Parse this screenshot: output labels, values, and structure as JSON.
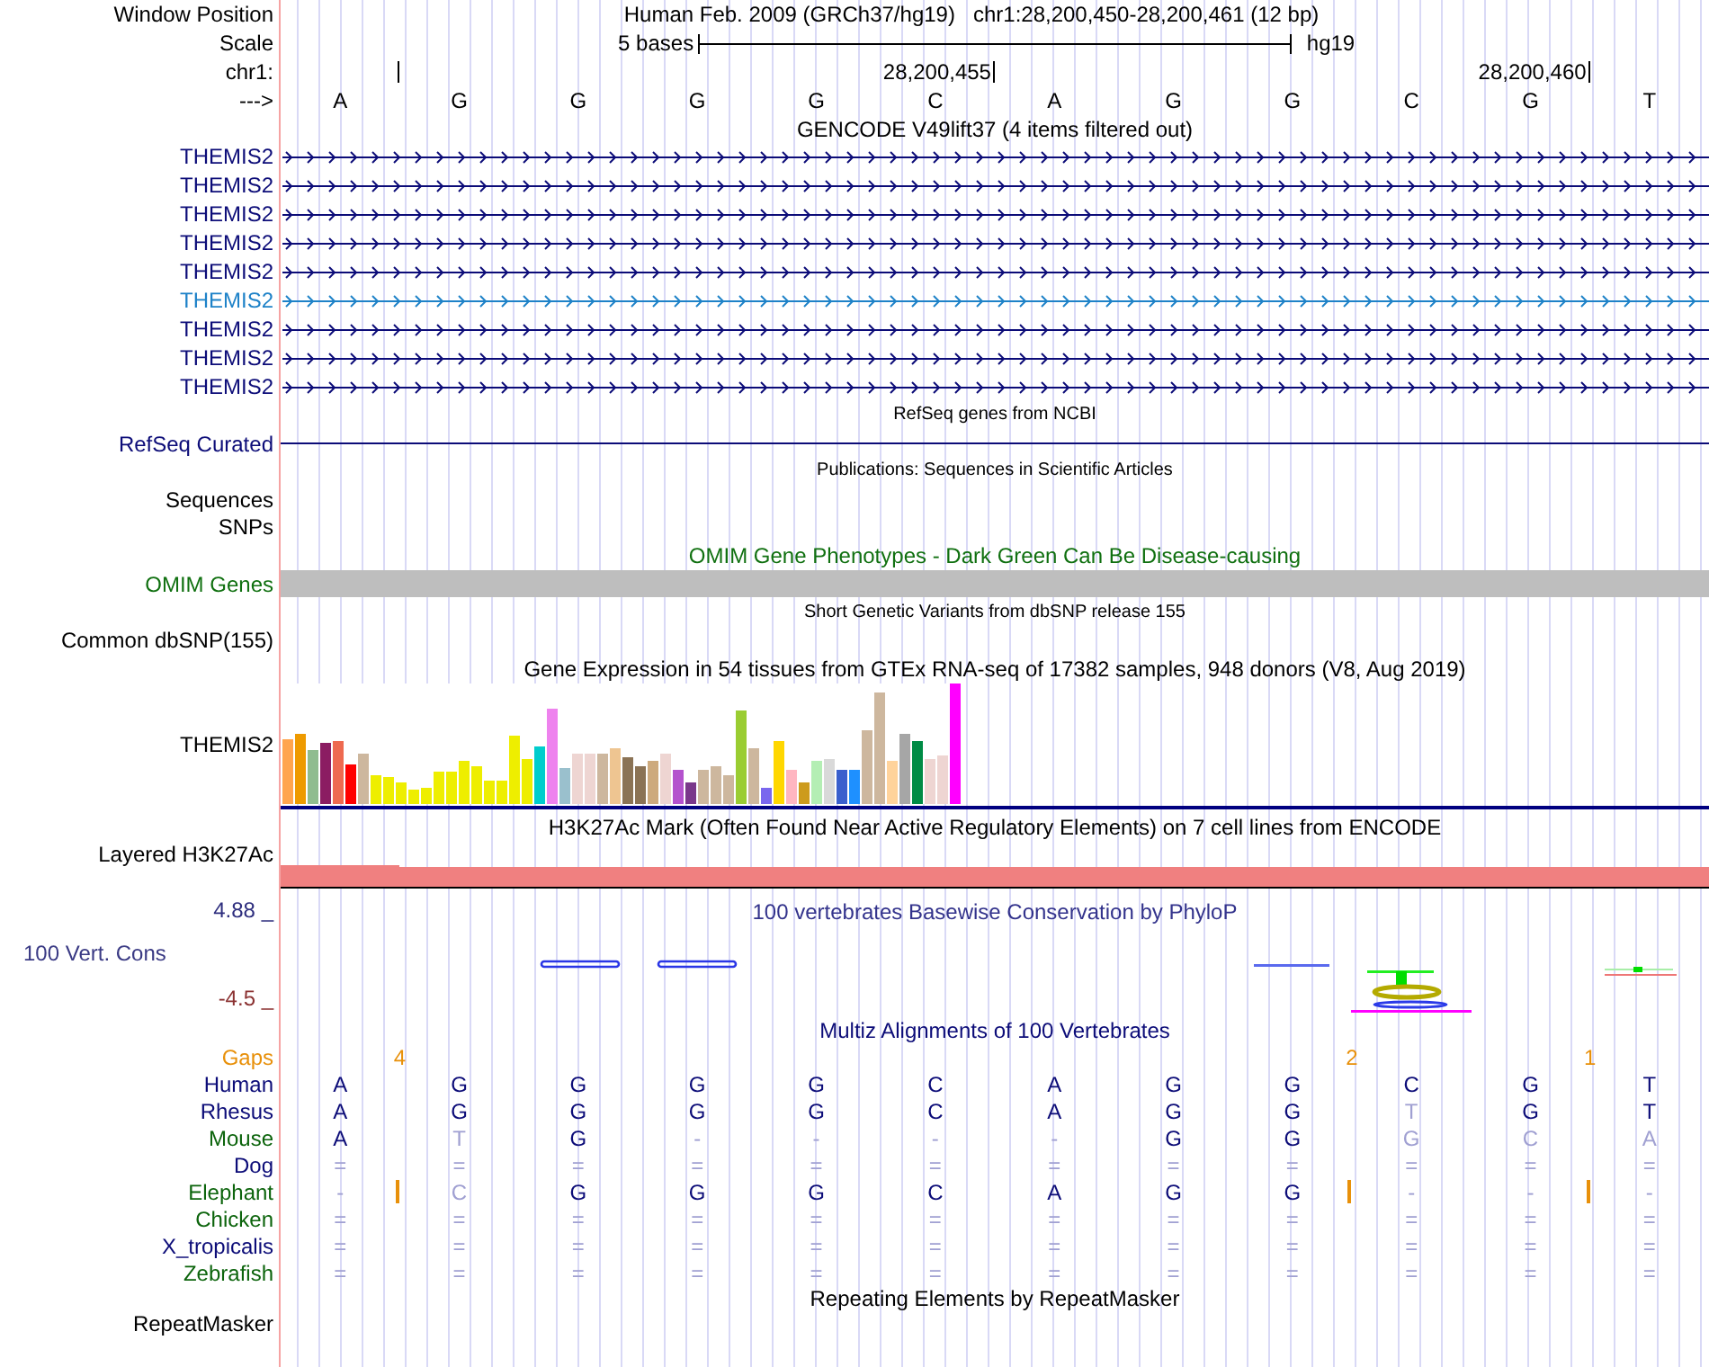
{
  "header": {
    "label": "Window Position",
    "assembly": "Human Feb. 2009 (GRCh37/hg19)",
    "position": "chr1:28,200,450-28,200,461 (12 bp)"
  },
  "scale": {
    "label": "Scale",
    "span": "5 bases",
    "assembly": "hg19"
  },
  "chrom_ruler": {
    "label": "chr1:",
    "columns": [
      {
        "kind": "tick"
      },
      {
        "kind": "plain"
      },
      {
        "kind": "plain"
      },
      {
        "kind": "plain"
      },
      {
        "kind": "plain"
      },
      {
        "kind": "tick",
        "label": "28,200,455"
      },
      {
        "kind": "plain"
      },
      {
        "kind": "plain"
      },
      {
        "kind": "plain"
      },
      {
        "kind": "plain"
      },
      {
        "kind": "tick",
        "label": "28,200,460"
      },
      {
        "kind": "plain"
      }
    ]
  },
  "sequence": {
    "label": "--->",
    "bases": [
      "A",
      "G",
      "G",
      "G",
      "G",
      "C",
      "A",
      "G",
      "G",
      "C",
      "G",
      "T"
    ]
  },
  "gencode": {
    "title": "GENCODE V49lift37 (4 items filtered out)",
    "transcripts": [
      {
        "name": "THEMIS2",
        "color": "#0c0c78"
      },
      {
        "name": "THEMIS2",
        "color": "#0c0c78"
      },
      {
        "name": "THEMIS2",
        "color": "#0c0c78"
      },
      {
        "name": "THEMIS2",
        "color": "#0c0c78"
      },
      {
        "name": "THEMIS2",
        "color": "#0c0c78"
      },
      {
        "name": "THEMIS2",
        "color": "#1e82c8"
      },
      {
        "name": "THEMIS2",
        "color": "#0c0c78"
      },
      {
        "name": "THEMIS2",
        "color": "#0c0c78"
      },
      {
        "name": "THEMIS2",
        "color": "#0c0c78"
      }
    ]
  },
  "refseq": {
    "title": "RefSeq genes from NCBI",
    "label": "RefSeq Curated"
  },
  "publications": {
    "title": "Publications: Sequences in Scientific Articles",
    "label": "Sequences"
  },
  "snps": {
    "label": "SNPs"
  },
  "omim": {
    "title": "OMIM Gene Phenotypes - Dark Green Can Be Disease-causing",
    "label": "OMIM Genes"
  },
  "dbsnp": {
    "title": "Short Genetic Variants from dbSNP release 155",
    "label": "Common dbSNP(155)"
  },
  "gtex": {
    "title": "Gene Expression in 54 tissues from GTEx RNA-seq of 17382 samples, 948 donors (V8, Aug 2019)",
    "label": "THEMIS2"
  },
  "h3k27ac": {
    "title": "H3K27Ac Mark (Often Found Near Active Regulatory Elements) on 7 cell lines from ENCODE",
    "label": "Layered H3K27Ac"
  },
  "phylop": {
    "title": "100 vertebrates Basewise Conservation by PhyloP",
    "label": "100 Vert. Cons",
    "axis_max": "4.88 _",
    "axis_min": "-4.5 _"
  },
  "multiz": {
    "title": "Multiz Alignments of 100 Vertebrates",
    "gaps": {
      "label": "Gaps",
      "columns": [
        {
          "kind": "gap",
          "count": "4"
        },
        {
          "kind": "plain"
        },
        {
          "kind": "plain"
        },
        {
          "kind": "plain"
        },
        {
          "kind": "plain"
        },
        {
          "kind": "plain"
        },
        {
          "kind": "plain"
        },
        {
          "kind": "plain"
        },
        {
          "kind": "gap",
          "count": "2"
        },
        {
          "kind": "plain"
        },
        {
          "kind": "gap",
          "count": "1"
        },
        {
          "kind": "plain"
        }
      ]
    },
    "species": [
      {
        "name": "Human",
        "color": "#0c0c78",
        "cells": [
          {
            "base": "A",
            "faded": false
          },
          {
            "base": "G",
            "faded": false
          },
          {
            "base": "G",
            "faded": false
          },
          {
            "base": "G",
            "faded": false
          },
          {
            "base": "G",
            "faded": false
          },
          {
            "base": "C",
            "faded": false
          },
          {
            "base": "A",
            "faded": false
          },
          {
            "base": "G",
            "faded": false
          },
          {
            "base": "G",
            "faded": false
          },
          {
            "base": "C",
            "faded": false
          },
          {
            "base": "G",
            "faded": false
          },
          {
            "base": "T",
            "faded": false
          }
        ]
      },
      {
        "name": "Rhesus",
        "color": "#0c0c78",
        "cells": [
          {
            "base": "A",
            "faded": false
          },
          {
            "base": "G",
            "faded": false
          },
          {
            "base": "G",
            "faded": false
          },
          {
            "base": "G",
            "faded": false
          },
          {
            "base": "G",
            "faded": false
          },
          {
            "base": "C",
            "faded": false
          },
          {
            "base": "A",
            "faded": false
          },
          {
            "base": "G",
            "faded": false
          },
          {
            "base": "G",
            "faded": false
          },
          {
            "base": "T",
            "faded": true
          },
          {
            "base": "G",
            "faded": false
          },
          {
            "base": "T",
            "faded": false
          }
        ]
      },
      {
        "name": "Mouse",
        "color": "#0c640c",
        "cells": [
          {
            "base": "A",
            "faded": false
          },
          {
            "base": "T",
            "faded": true
          },
          {
            "base": "G",
            "faded": false
          },
          {
            "base": "-",
            "faded": true
          },
          {
            "base": "-",
            "faded": true
          },
          {
            "base": "-",
            "faded": true
          },
          {
            "base": "-",
            "faded": true
          },
          {
            "base": "G",
            "faded": false
          },
          {
            "base": "G",
            "faded": false
          },
          {
            "base": "G",
            "faded": true
          },
          {
            "base": "C",
            "faded": true
          },
          {
            "base": "A",
            "faded": true
          }
        ]
      },
      {
        "name": "Dog",
        "color": "#0c0c78",
        "cells": [
          {
            "base": "=",
            "faded": true
          },
          {
            "base": "=",
            "faded": true
          },
          {
            "base": "=",
            "faded": true
          },
          {
            "base": "=",
            "faded": true
          },
          {
            "base": "=",
            "faded": true
          },
          {
            "base": "=",
            "faded": true
          },
          {
            "base": "=",
            "faded": true
          },
          {
            "base": "=",
            "faded": true
          },
          {
            "base": "=",
            "faded": true
          },
          {
            "base": "=",
            "faded": true
          },
          {
            "base": "=",
            "faded": true
          },
          {
            "base": "=",
            "faded": true
          }
        ]
      },
      {
        "name": "Elephant",
        "color": "#0c640c",
        "cells": [
          {
            "base": "-",
            "faded": true,
            "insertion_after": true
          },
          {
            "base": "C",
            "faded": true,
            "insertion_after": false
          },
          {
            "base": "G",
            "faded": false,
            "insertion_after": false
          },
          {
            "base": "G",
            "faded": false,
            "insertion_after": false
          },
          {
            "base": "G",
            "faded": false,
            "insertion_after": false
          },
          {
            "base": "C",
            "faded": false,
            "insertion_after": false
          },
          {
            "base": "A",
            "faded": false,
            "insertion_after": false
          },
          {
            "base": "G",
            "faded": false,
            "insertion_after": false
          },
          {
            "base": "G",
            "faded": false,
            "insertion_after": true
          },
          {
            "base": "-",
            "faded": true,
            "insertion_after": false
          },
          {
            "base": "-",
            "faded": true,
            "insertion_after": true
          },
          {
            "base": "-",
            "faded": true,
            "insertion_after": false
          }
        ]
      },
      {
        "name": "Chicken",
        "color": "#0c640c",
        "cells": [
          {
            "base": "=",
            "faded": true
          },
          {
            "base": "=",
            "faded": true
          },
          {
            "base": "=",
            "faded": true
          },
          {
            "base": "=",
            "faded": true
          },
          {
            "base": "=",
            "faded": true
          },
          {
            "base": "=",
            "faded": true
          },
          {
            "base": "=",
            "faded": true
          },
          {
            "base": "=",
            "faded": true
          },
          {
            "base": "=",
            "faded": true
          },
          {
            "base": "=",
            "faded": true
          },
          {
            "base": "=",
            "faded": true
          },
          {
            "base": "=",
            "faded": true
          }
        ]
      },
      {
        "name": "X_tropicalis",
        "color": "#0c0c78",
        "cells": [
          {
            "base": "=",
            "faded": true
          },
          {
            "base": "=",
            "faded": true
          },
          {
            "base": "=",
            "faded": true
          },
          {
            "base": "=",
            "faded": true
          },
          {
            "base": "=",
            "faded": true
          },
          {
            "base": "=",
            "faded": true
          },
          {
            "base": "=",
            "faded": true
          },
          {
            "base": "=",
            "faded": true
          },
          {
            "base": "=",
            "faded": true
          },
          {
            "base": "=",
            "faded": true
          },
          {
            "base": "=",
            "faded": true
          },
          {
            "base": "=",
            "faded": true
          }
        ]
      },
      {
        "name": "Zebrafish",
        "color": "#0c640c",
        "cells": [
          {
            "base": "=",
            "faded": true
          },
          {
            "base": "=",
            "faded": true
          },
          {
            "base": "=",
            "faded": true
          },
          {
            "base": "=",
            "faded": true
          },
          {
            "base": "=",
            "faded": true
          },
          {
            "base": "=",
            "faded": true
          },
          {
            "base": "=",
            "faded": true
          },
          {
            "base": "=",
            "faded": true
          },
          {
            "base": "=",
            "faded": true
          },
          {
            "base": "=",
            "faded": true
          },
          {
            "base": "=",
            "faded": true
          },
          {
            "base": "=",
            "faded": true
          }
        ]
      }
    ]
  },
  "repeatmasker": {
    "title": "Repeating Elements by RepeatMasker",
    "label": "RepeatMasker"
  }
}
